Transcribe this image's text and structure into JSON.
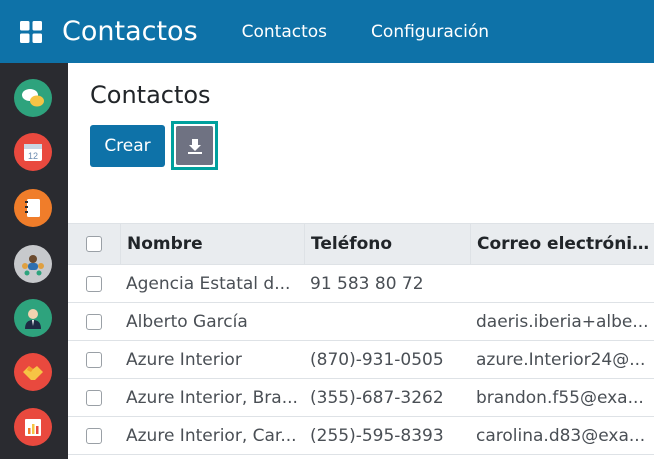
{
  "navbar": {
    "app_title": "Contactos",
    "menu": [
      {
        "label": "Contactos"
      },
      {
        "label": "Configuración"
      }
    ]
  },
  "sidebar": {
    "apps": [
      {
        "icon": "discuss-icon",
        "color": "#2ea37d"
      },
      {
        "icon": "calendar-icon",
        "color": "#e9493e"
      },
      {
        "icon": "notes-icon",
        "color": "#f07d2a"
      },
      {
        "icon": "contacts-icon",
        "color": "#c7c9cc"
      },
      {
        "icon": "employees-icon",
        "color": "#2ea37d"
      },
      {
        "icon": "crm-icon",
        "color": "#e9493e"
      },
      {
        "icon": "reports-icon",
        "color": "#e9493e"
      }
    ]
  },
  "main": {
    "title": "Contactos",
    "create_label": "Crear",
    "download_icon": "download-icon"
  },
  "table": {
    "headers": {
      "name": "Nombre",
      "phone": "Teléfono",
      "email": "Correo electrónic..."
    },
    "rows": [
      {
        "name": "Agencia Estatal d...",
        "phone": "91 583 80 72",
        "email": ""
      },
      {
        "name": "Alberto García",
        "phone": "",
        "email": "daeris.iberia+albe..."
      },
      {
        "name": "Azure Interior",
        "phone": "(870)-931-0505",
        "email": "azure.Interior24@..."
      },
      {
        "name": "Azure Interior, Bra...",
        "phone": "(355)-687-3262",
        "email": "brandon.f55@exa..."
      },
      {
        "name": "Azure Interior, Car...",
        "phone": "(255)-595-8393",
        "email": "carolina.d83@exa..."
      }
    ]
  },
  "colors": {
    "navbar": "#0e72a8",
    "sidebar": "#2a2b30",
    "primary_button": "#0e72a8",
    "focus_ring": "#00a09d"
  }
}
